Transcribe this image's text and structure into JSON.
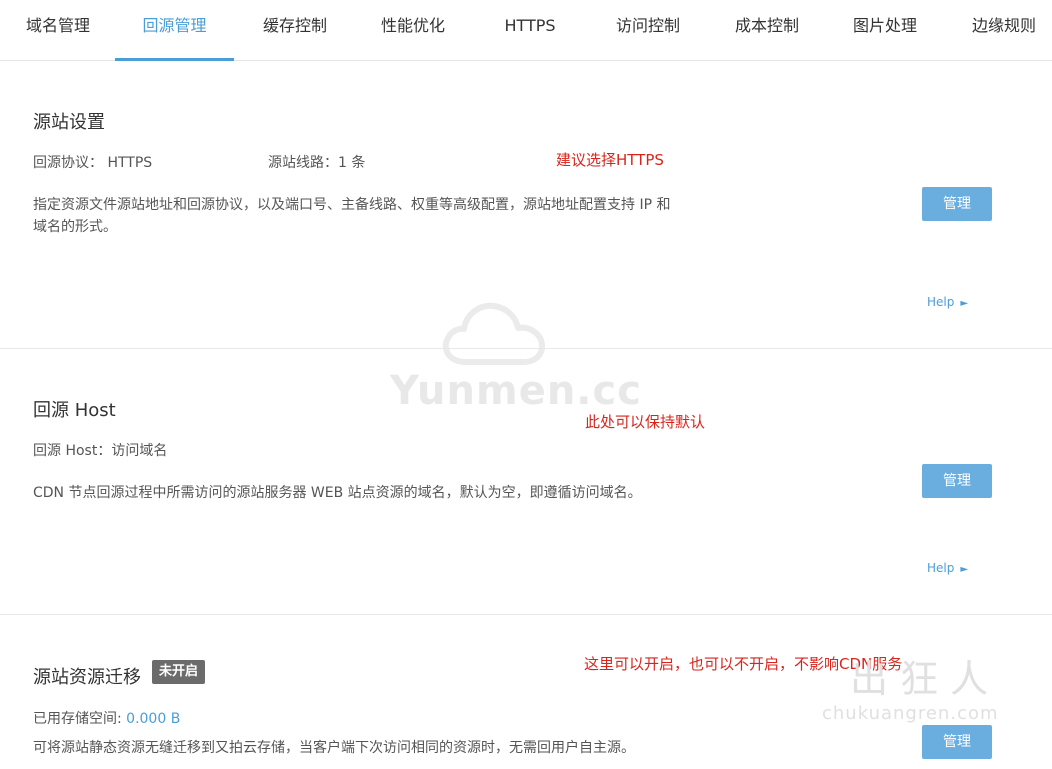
{
  "tabs": [
    {
      "label": "域名管理"
    },
    {
      "label": "回源管理",
      "active": true
    },
    {
      "label": "缓存控制"
    },
    {
      "label": "性能优化"
    },
    {
      "label": "HTTPS"
    },
    {
      "label": "访问控制"
    },
    {
      "label": "成本控制"
    },
    {
      "label": "图片处理"
    },
    {
      "label": "边缘规则"
    }
  ],
  "origin_settings": {
    "title": "源站设置",
    "protocol": "回源协议： HTTPS",
    "lines": "源站线路：1 条",
    "note": "建议选择HTTPS",
    "description_line1": "指定资源文件源站地址和回源协议，以及端口号、主备线路、权重等高级配置，源站地址配置支持 IP 和",
    "description_line2": "域名的形式。",
    "manage_label": "管理",
    "help_label": "Help",
    "help_arrow": "►"
  },
  "origin_host": {
    "title": "回源 Host",
    "host": "回源 Host：访问域名",
    "note": "此处可以保持默认",
    "description": "CDN 节点回源过程中所需访问的源站服务器 WEB 站点资源的域名，默认为空，即遵循访问域名。",
    "manage_label": "管理",
    "help_label": "Help",
    "help_arrow": "►"
  },
  "origin_migration": {
    "title": "源站资源迁移",
    "status_badge": "未开启",
    "note": "这里可以开启，也可以不开启，不影响CDN服务",
    "storage_label": "已用存储空间: ",
    "storage_value": "0.000 B",
    "description": "可将源站静态资源无缝迁移到又拍云存储，当客户端下次访问相同的资源时，无需回用户自主源。",
    "manage_label": "管理"
  },
  "watermarks": {
    "center_text": "Yunmen.cc",
    "corner_text": "出 狂 人",
    "corner_domain": "chukuangren.com"
  },
  "colors": {
    "accent": "#4a9ed8",
    "button": "#6aaee0",
    "note_red": "#d9241c",
    "badge_gray": "#6b6b6b"
  }
}
